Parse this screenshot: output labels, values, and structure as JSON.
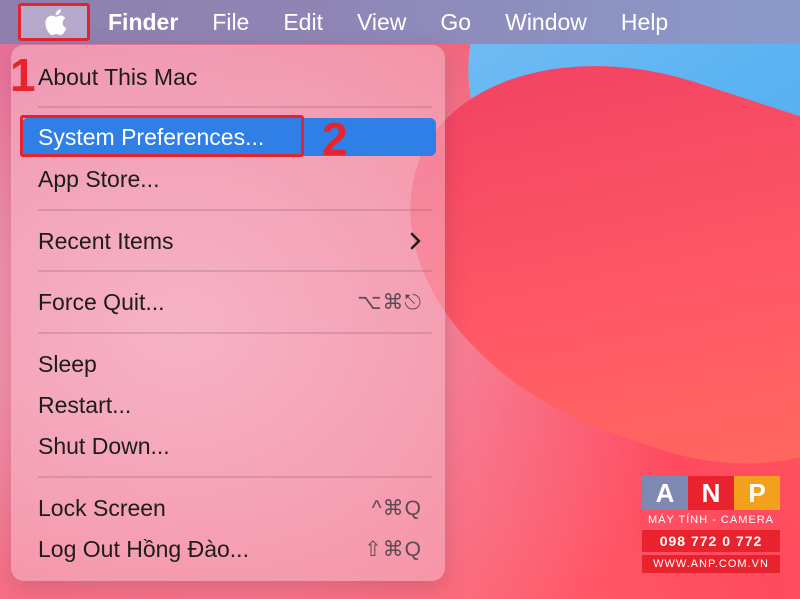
{
  "menubar": {
    "apple_icon": "apple-logo-icon",
    "items": [
      {
        "label": "Finder",
        "bold": true
      },
      {
        "label": "File"
      },
      {
        "label": "Edit"
      },
      {
        "label": "View"
      },
      {
        "label": "Go"
      },
      {
        "label": "Window"
      },
      {
        "label": "Help"
      }
    ]
  },
  "apple_menu": {
    "items": [
      {
        "label": "About This Mac"
      },
      {
        "label": "System Preferences...",
        "selected": true
      },
      {
        "label": "App Store..."
      },
      {
        "label": "Recent Items",
        "submenu_icon": "chevron-right-icon"
      },
      {
        "label": "Force Quit...",
        "shortcut": "⌥⌘⎋"
      },
      {
        "label": "Sleep"
      },
      {
        "label": "Restart..."
      },
      {
        "label": "Shut Down..."
      },
      {
        "label": "Lock Screen",
        "shortcut": "^⌘Q"
      },
      {
        "label": "Log Out Hồng Đào...",
        "shortcut": "⇧⌘Q"
      }
    ]
  },
  "annotations": {
    "step1": "1",
    "step2": "2",
    "highlight_color": "#e5232e"
  },
  "watermark": {
    "letters": [
      "A",
      "N",
      "P"
    ],
    "subtitle": "MÁY TÍNH - CAMERA",
    "phone": "098 772 0 772",
    "website": "WWW.ANP.COM.VN"
  },
  "colors": {
    "selection": "#2f7fe6",
    "menubar": "#8e80ad"
  }
}
